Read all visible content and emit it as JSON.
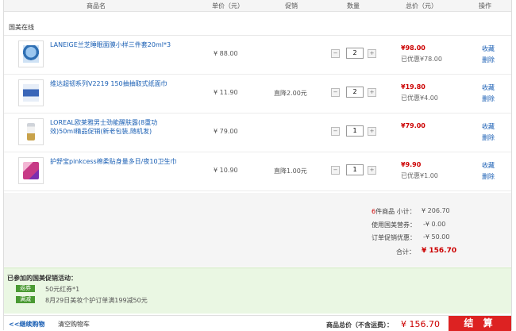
{
  "header": {
    "product": "商品名",
    "unit_price": "单价（元）",
    "promotion": "促销",
    "quantity": "数量",
    "total": "总价（元）",
    "operation": "操作"
  },
  "store": "国美在线",
  "items": [
    {
      "name": "LANEIGE兰芝睡眠面膜小样三件套20ml*3",
      "price": "¥ 88.00",
      "promo": "",
      "qty": "2",
      "total": "¥98.00",
      "saved": "已优惠¥78.00",
      "op1": "收藏",
      "op2": "删除"
    },
    {
      "name": "维达超韧系列V2219 150抽抽取式纸面巾",
      "price": "¥ 11.90",
      "promo": "直降2.00元",
      "qty": "2",
      "total": "¥19.80",
      "saved": "已优惠¥4.00",
      "op1": "收藏",
      "op2": "删除"
    },
    {
      "name": "LOREAL欧莱雅男士劲能醒肤露(8重功效)50ml精品促销(新老包装,随机发)",
      "price": "¥ 79.00",
      "promo": "",
      "qty": "1",
      "total": "¥79.00",
      "saved": "",
      "op1": "收藏",
      "op2": "删除"
    },
    {
      "name": "护舒宝pinkcess棉柔贴身量多日/夜10卫生巾",
      "price": "¥ 10.90",
      "promo": "直降1.00元",
      "qty": "1",
      "total": "¥9.90",
      "saved": "已优惠¥1.00",
      "op1": "收藏",
      "op2": "删除"
    }
  ],
  "summary": {
    "count": "6",
    "count_text": "件商品  小计：",
    "subtotal": "¥ 206.70",
    "voucher_label": "使用国美营券：",
    "voucher": "-¥ 0.00",
    "discount_label": "订单促销优惠：",
    "discount": "-¥ 50.00",
    "grand_label": "合计：",
    "grand": "¥ 156.70"
  },
  "promotions": {
    "title": "已参加的国美促销活动：",
    "list": [
      {
        "tag": "返券",
        "text": "50元红券*1"
      },
      {
        "tag": "满减",
        "text": "8月29日美妆个护订单满199减50元"
      }
    ]
  },
  "bottom": {
    "continue": "<<继续购物",
    "clear": "清空购物车",
    "grand_label": "商品总价（不含运费）：",
    "grand": "¥ 156.70",
    "checkout": "结 算"
  },
  "colors": {
    "accent_red": "#cc0000",
    "link_blue": "#1a5fb4",
    "promo_green": "#4a9a33"
  }
}
